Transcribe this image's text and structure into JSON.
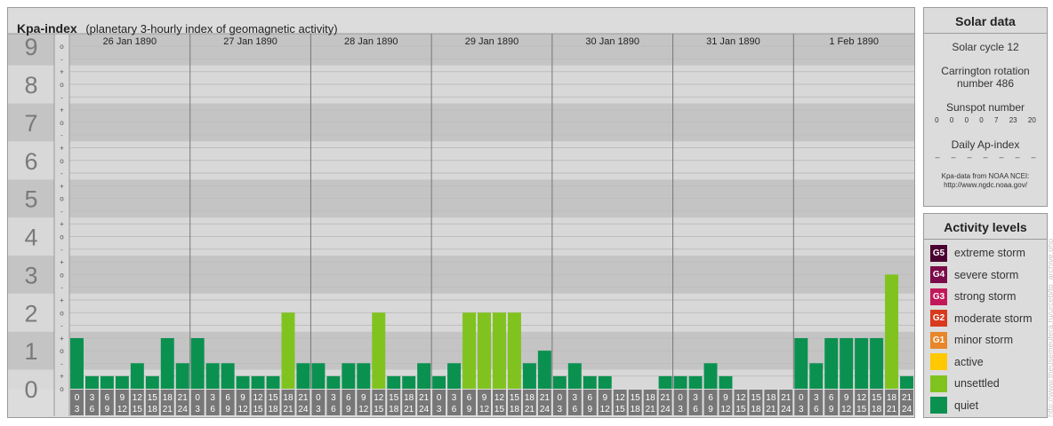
{
  "title": "Kpa-index",
  "subtitle": "(planetary 3-hourly index of geomagnetic activity)",
  "chart_data": {
    "type": "bar",
    "y_axis_labels": [
      "0",
      "1",
      "2",
      "3",
      "4",
      "5",
      "6",
      "7",
      "8",
      "9"
    ],
    "y_minor_labels": [
      "-",
      "o",
      "+"
    ],
    "ylim": [
      0,
      9.33
    ],
    "days": [
      "26 Jan 1890",
      "27 Jan 1890",
      "28 Jan 1890",
      "29 Jan 1890",
      "30 Jan 1890",
      "31 Jan 1890",
      "1 Feb 1890"
    ],
    "hour_start_labels": [
      "0",
      "3",
      "6",
      "9",
      "12",
      "15",
      "18",
      "21"
    ],
    "hour_end_labels": [
      "3",
      "6",
      "9",
      "12",
      "15",
      "18",
      "21",
      "24"
    ],
    "values": [
      [
        1.33,
        0.33,
        0.33,
        0.33,
        0.67,
        0.33,
        1.33,
        0.67
      ],
      [
        1.33,
        0.67,
        0.67,
        0.33,
        0.33,
        0.33,
        2.0,
        0.67
      ],
      [
        0.67,
        0.33,
        0.67,
        0.67,
        2.0,
        0.33,
        0.33,
        0.67
      ],
      [
        0.33,
        0.67,
        2.0,
        2.0,
        2.0,
        2.0,
        0.67,
        1.0
      ],
      [
        0.33,
        0.67,
        0.33,
        0.33,
        0.0,
        0.0,
        0.0,
        0.33
      ],
      [
        0.33,
        0.33,
        0.67,
        0.33,
        0.0,
        0.0,
        0.0,
        0.0
      ],
      [
        1.33,
        0.67,
        1.33,
        1.33,
        1.33,
        1.33,
        3.0,
        0.33
      ]
    ],
    "colors": {
      "quiet": "#0a9150",
      "unsettled": "#80c31f",
      "active": "#ffc800",
      "plot_band_dark": "#c4c4c4",
      "plot_band_light": "#d8d8d8",
      "grid": "#bdbdbd",
      "hour_box": "#777777"
    }
  },
  "solar": {
    "title": "Solar data",
    "cycle": "Solar cycle 12",
    "carrington_line1": "Carrington rotation",
    "carrington_line2": "number 486",
    "sunspot_label": "Sunspot number",
    "sunspot_values": [
      "0",
      "0",
      "0",
      "0",
      "7",
      "23",
      "20"
    ],
    "ap_label": "Daily Ap-index",
    "ap_values": [
      "--",
      "--",
      "--",
      "--",
      "--",
      "--",
      "--"
    ],
    "source_line1": "Kpa-data from NOAA NCEI:",
    "source_line2": "http://www.ngdc.noaa.gov/"
  },
  "levels": {
    "title": "Activity levels",
    "items": [
      {
        "code": "G5",
        "label": "extreme storm",
        "color": "#4a0030"
      },
      {
        "code": "G4",
        "label": "severe storm",
        "color": "#7b0a4a"
      },
      {
        "code": "G3",
        "label": "strong storm",
        "color": "#c2185b"
      },
      {
        "code": "G2",
        "label": "moderate storm",
        "color": "#d83a1e"
      },
      {
        "code": "G1",
        "label": "minor storm",
        "color": "#e8862a"
      },
      {
        "code": "",
        "label": "active",
        "color": "#ffc800"
      },
      {
        "code": "",
        "label": "unsettled",
        "color": "#80c31f"
      },
      {
        "code": "",
        "label": "quiet",
        "color": "#0a9150"
      }
    ]
  },
  "watermark": "http://www.theusemeufera.ru/urceb/to_archive.php"
}
